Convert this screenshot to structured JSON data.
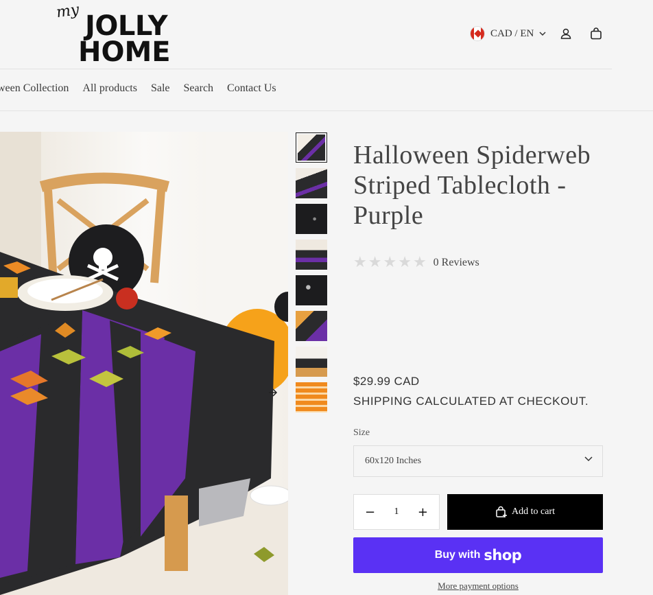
{
  "header": {
    "logo": {
      "my": "my",
      "line1": "JOLLY",
      "line2": "HOME"
    },
    "locale_label": "CAD / EN",
    "icons": [
      "canada-flag-icon",
      "chevron-down-icon",
      "account-icon",
      "cart-icon"
    ]
  },
  "nav": {
    "items": [
      "oween Collection",
      "All products",
      "Sale",
      "Search",
      "Contact Us"
    ]
  },
  "product": {
    "title": "Halloween Spiderweb Striped Tablecloth - Purple",
    "rating": {
      "stars": 0,
      "max": 5,
      "reviews_label": "0 Reviews"
    },
    "price": "$29.99 CAD",
    "shipping": "SHIPPING CALCULATED AT CHECKOUT.",
    "size_label": "Size",
    "size_value": "60x120 Inches",
    "quantity": "1",
    "minus": "−",
    "plus": "+",
    "add_to_cart": "Add to cart",
    "buy_with": "Buy with",
    "shop_word": "shop",
    "more_payment": "More payment options"
  },
  "gallery": {
    "thumbnail_count": 8,
    "selected_index": 0
  },
  "colors": {
    "shop_pay": "#5a31f4",
    "tablecloth_black": "#2a2a2c",
    "tablecloth_purple": "#6b2fa6",
    "balloon_orange": "#f6a21a"
  }
}
